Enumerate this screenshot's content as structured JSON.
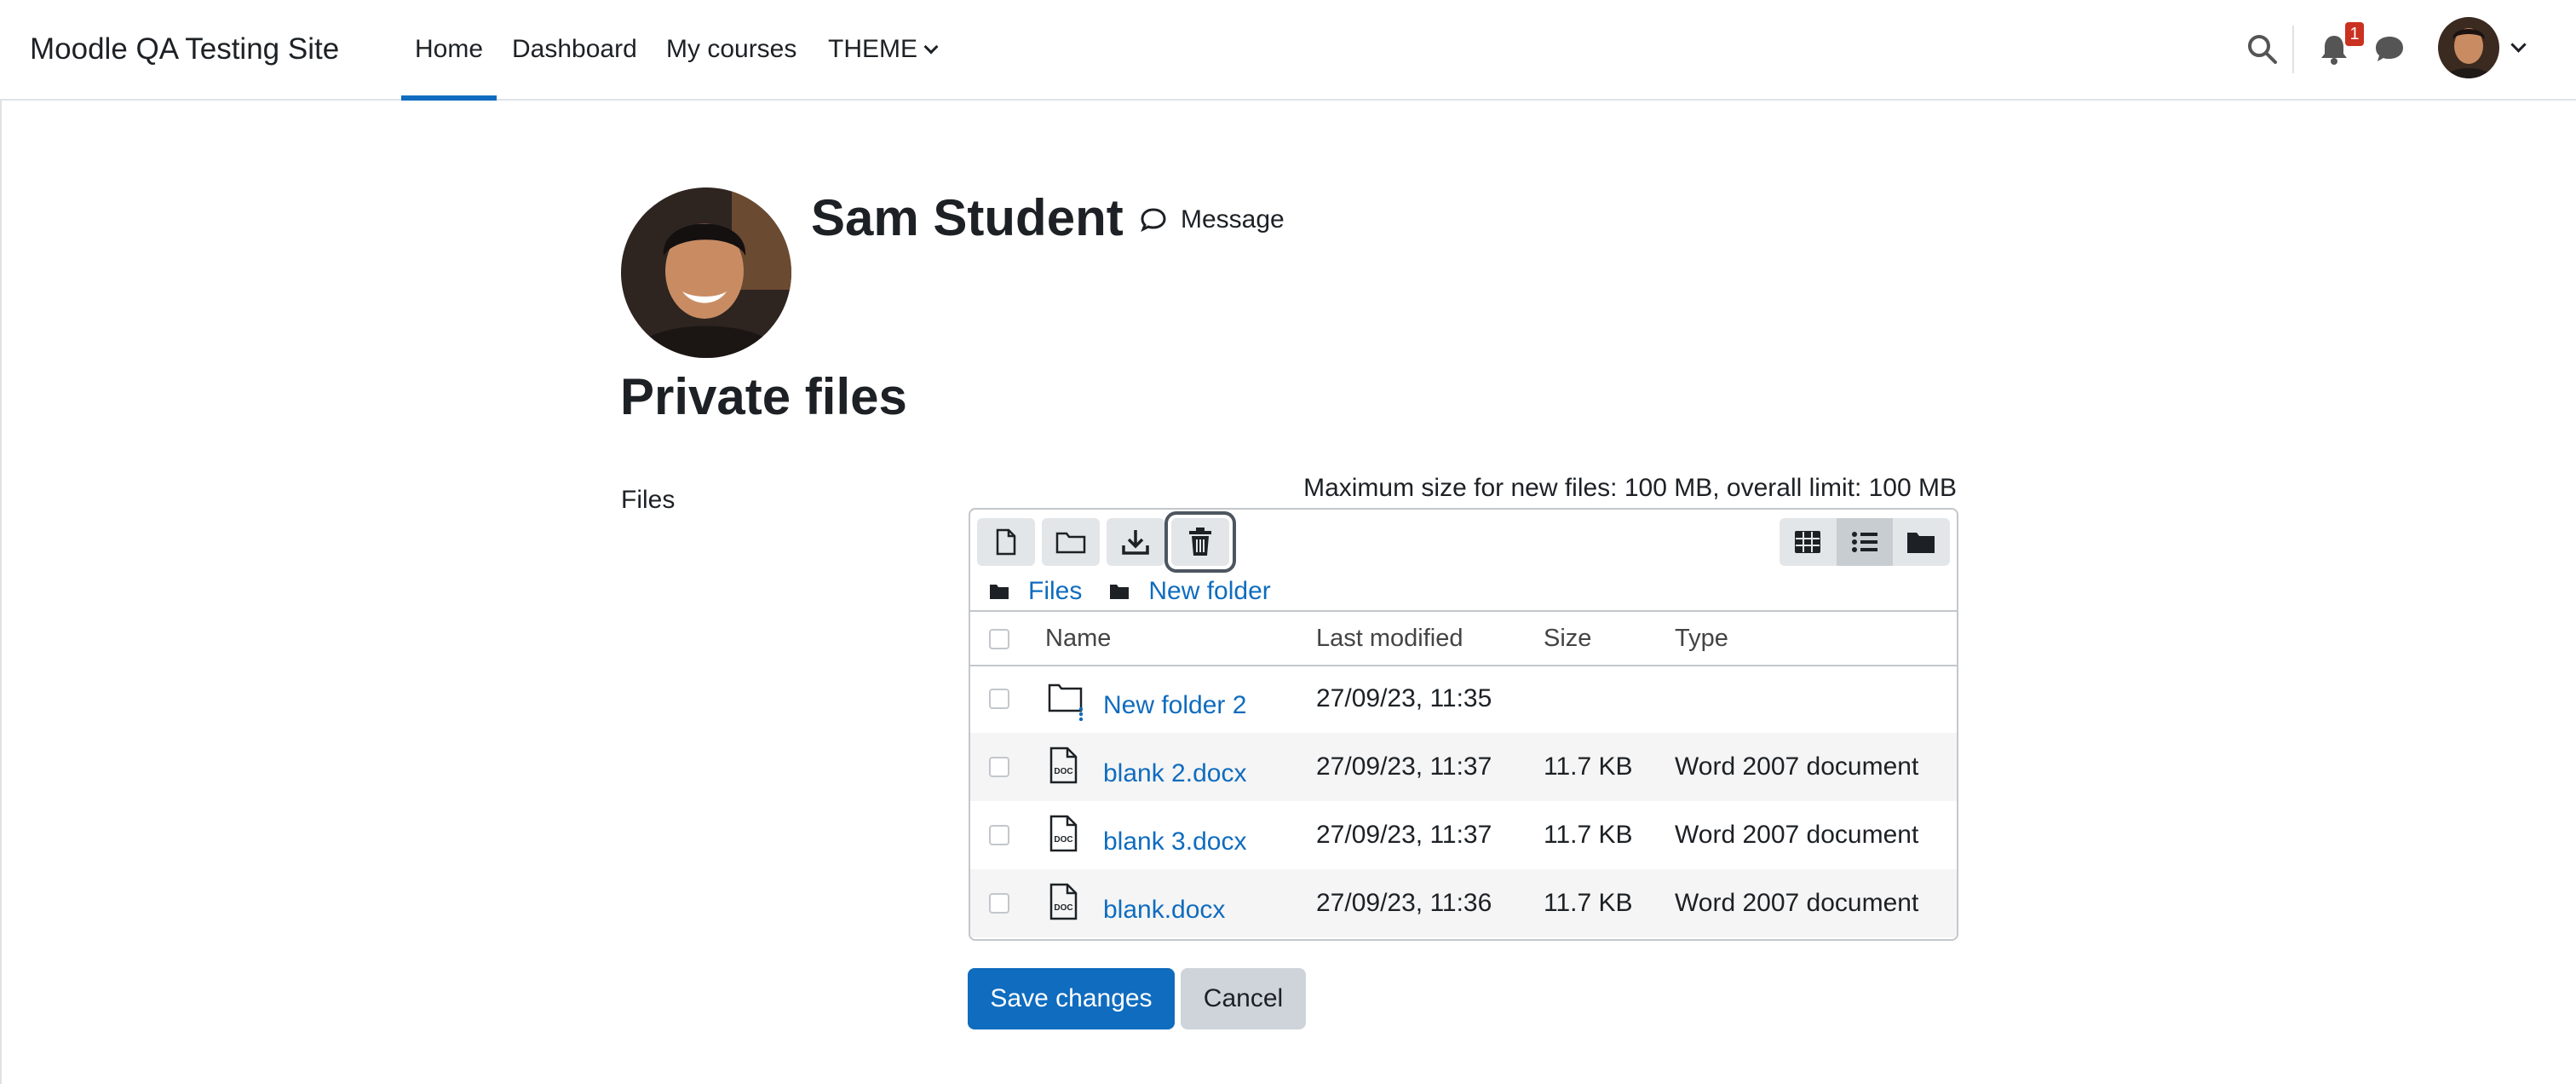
{
  "navbar": {
    "site_name": "Moodle QA Testing Site",
    "links": [
      "Home",
      "Dashboard",
      "My courses",
      "THEME"
    ],
    "active": "Home",
    "notification_count": "1",
    "accent_color": "#0f6cbf"
  },
  "profile": {
    "name": "Sam Student",
    "message_label": "Message"
  },
  "page": {
    "title": "Private files"
  },
  "form": {
    "files_label": "Files",
    "max_size_text": "Maximum size for new files: 100 MB, overall limit: 100 MB",
    "toolbar": {
      "buttons": [
        "add-file-icon",
        "create-folder-icon",
        "download-icon",
        "delete-icon"
      ],
      "views": [
        "grid-view-icon",
        "list-view-icon",
        "tree-view-icon"
      ],
      "active_view": "list-view-icon"
    },
    "breadcrumb": [
      "Files",
      "New folder"
    ],
    "columns": [
      "Name",
      "Last modified",
      "Size",
      "Type"
    ],
    "rows": [
      {
        "name": "New folder 2",
        "modified": "27/09/23, 11:35",
        "size": "",
        "type": "",
        "icon": "folder-icon"
      },
      {
        "name": "blank 2.docx",
        "modified": "27/09/23, 11:37",
        "size": "11.7 KB",
        "type": "Word 2007 document",
        "icon": "doc-file-icon"
      },
      {
        "name": "blank 3.docx",
        "modified": "27/09/23, 11:37",
        "size": "11.7 KB",
        "type": "Word 2007 document",
        "icon": "doc-file-icon"
      },
      {
        "name": "blank.docx",
        "modified": "27/09/23, 11:36",
        "size": "11.7 KB",
        "type": "Word 2007 document",
        "icon": "doc-file-icon"
      }
    ],
    "save_label": "Save changes",
    "cancel_label": "Cancel"
  }
}
